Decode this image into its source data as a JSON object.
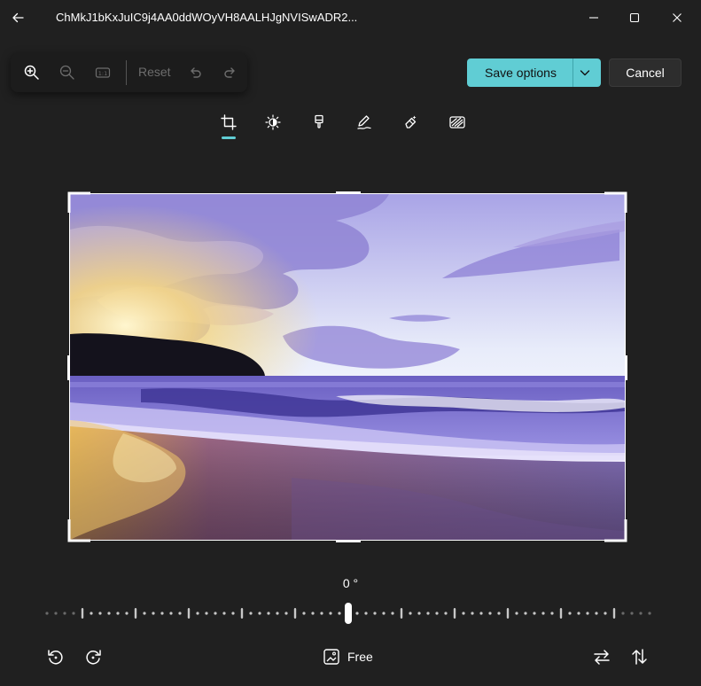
{
  "window": {
    "title": "ChMkJ1bKxJuIC9j4AA0ddWOyVH8AALHJgNVISwADR2...",
    "icons": [
      "back-arrow-icon",
      "minimize-icon",
      "maximize-icon",
      "close-icon"
    ]
  },
  "toolbar": {
    "zoom_in": "zoom-in-icon",
    "zoom_out": "zoom-out-icon",
    "actual_size": "actual-size-icon",
    "reset_label": "Reset",
    "undo": "undo-icon",
    "redo": "redo-icon",
    "save_label": "Save options",
    "cancel_label": "Cancel"
  },
  "tools": {
    "items": [
      "crop-icon",
      "adjustment-icon",
      "filter-icon",
      "markup-icon",
      "erase-icon",
      "background-blur-icon"
    ],
    "selected": "crop-icon"
  },
  "image": {
    "description_icon": "beach-sunset-photo"
  },
  "straighten": {
    "angle_label": "0 °",
    "value": 0
  },
  "bottom": {
    "rotate_left": "rotate-left-icon",
    "rotate_right": "rotate-right-icon",
    "aspect_label": "Free",
    "flip_horizontal": "flip-horizontal-icon",
    "flip_vertical": "flip-vertical-icon"
  },
  "colors": {
    "accent": "#60cdd4",
    "background": "#202020"
  }
}
